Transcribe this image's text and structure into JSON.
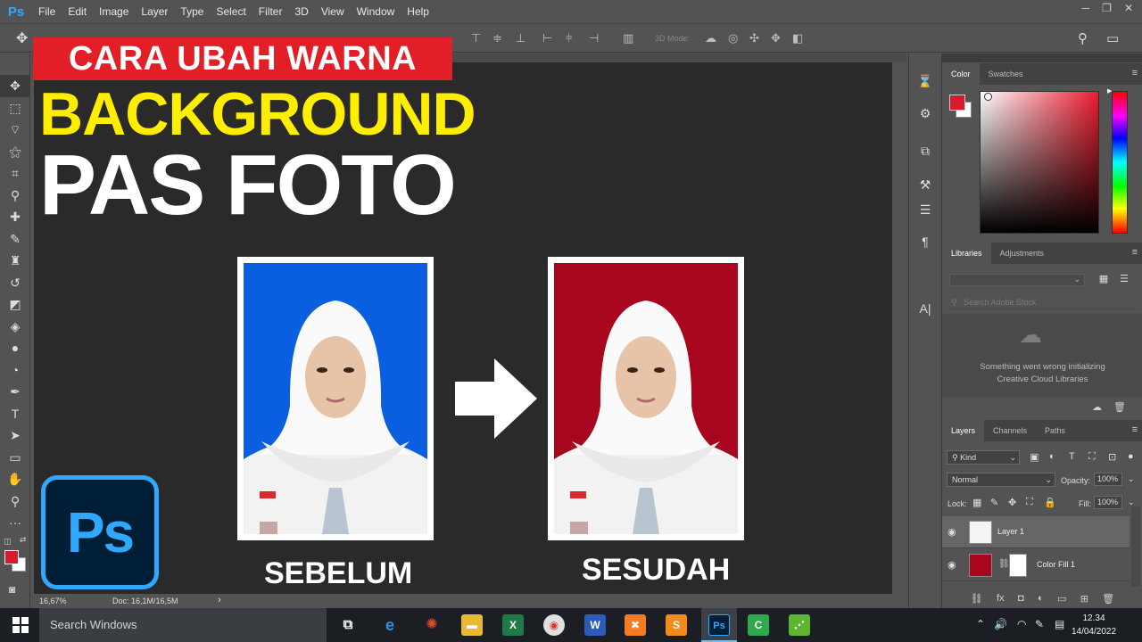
{
  "app": {
    "logo": "Ps",
    "menus": [
      "File",
      "Edit",
      "Image",
      "Layer",
      "Type",
      "Select",
      "Filter",
      "3D",
      "View",
      "Window",
      "Help"
    ],
    "window_controls": [
      "─",
      "❐",
      "✕"
    ]
  },
  "options_bar": {
    "mode_3d_label": "3D Mode:"
  },
  "overlay": {
    "title_line1": "CARA UBAH WARNA",
    "title_line2": "BACKGROUND",
    "title_line3": "PAS FOTO",
    "label_before": "SEBELUM",
    "label_after": "SESUDAH",
    "badge_text": "Ps",
    "photo_before_bg": "#0a5ee0",
    "photo_after_bg": "#a8061e"
  },
  "status_bar": {
    "zoom": "16,67%",
    "doc_size": "Doc: 16,1M/16,5M"
  },
  "color_panel": {
    "tabs": [
      "Color",
      "Swatches"
    ],
    "foreground_color": "#d51b2c",
    "background_color": "#ffffff"
  },
  "libraries_panel": {
    "tabs": [
      "Libraries",
      "Adjustments"
    ],
    "search_placeholder": "Search Adobe Stock",
    "error_message_line1": "Something went wrong initializing",
    "error_message_line2": "Creative Cloud Libraries"
  },
  "layers_panel": {
    "tabs": [
      "Layers",
      "Channels",
      "Paths"
    ],
    "filter_kind": "Kind",
    "blend_mode": "Normal",
    "opacity_label": "Opacity:",
    "opacity_value": "100%",
    "lock_label": "Lock:",
    "fill_label": "Fill:",
    "fill_value": "100%",
    "layers": [
      {
        "name": "Layer 1",
        "selected": true
      },
      {
        "name": "Color Fill 1",
        "selected": false,
        "fill_color": "#a8061e"
      }
    ]
  },
  "taskbar": {
    "search_placeholder": "Search Windows",
    "time": "12.34",
    "date": "14/04/2022"
  }
}
